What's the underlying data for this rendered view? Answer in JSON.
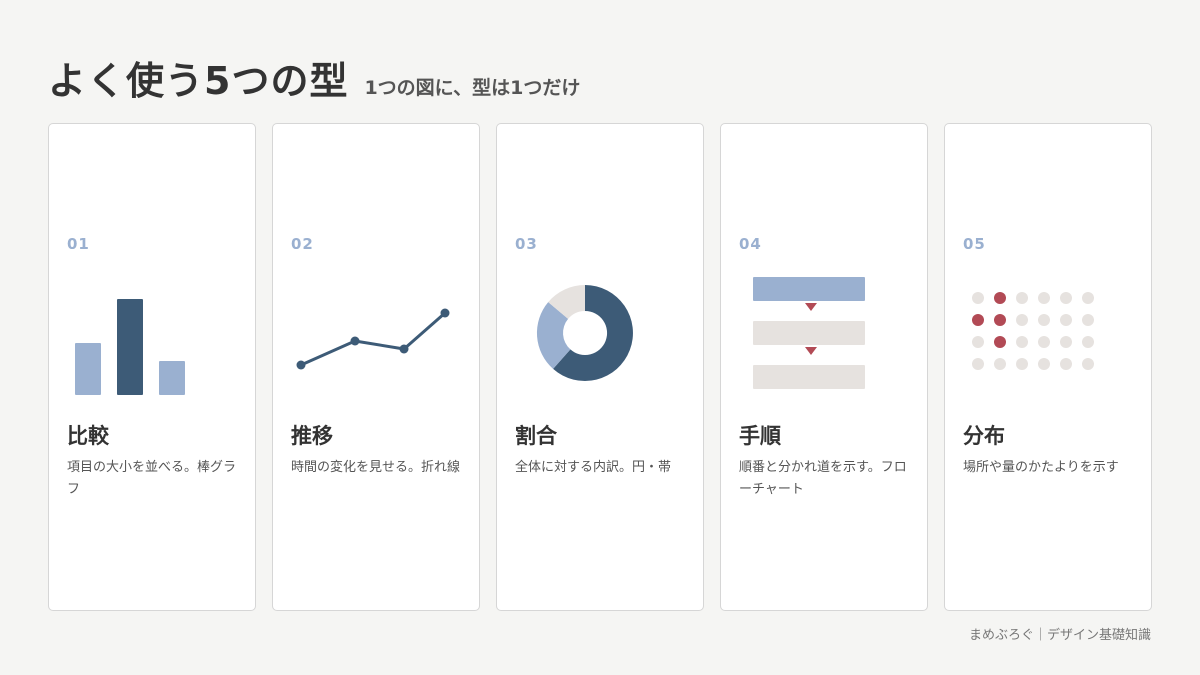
{
  "header": {
    "title": "よく使う5つの型",
    "subtitle": "1つの図に、型は1つだけ"
  },
  "colors": {
    "primary": "#3d5b77",
    "secondary": "#9ab0d0",
    "accent": "#b24a55",
    "neutral": "#e6e2df",
    "background": "#f5f5f3"
  },
  "cards": [
    {
      "number": "01",
      "title": "比較",
      "desc": "項目の大小を並べる。棒グラフ",
      "icon": "bar-chart-icon"
    },
    {
      "number": "02",
      "title": "推移",
      "desc": "時間の変化を見せる。折れ線",
      "icon": "line-chart-icon"
    },
    {
      "number": "03",
      "title": "割合",
      "desc": "全体に対する内訳。円・帯",
      "icon": "donut-chart-icon"
    },
    {
      "number": "04",
      "title": "手順",
      "desc": "順番と分かれ道を示す。フローチャート",
      "icon": "flowchart-icon"
    },
    {
      "number": "05",
      "title": "分布",
      "desc": "場所や量のかたよりを示す",
      "icon": "dot-distribution-icon"
    }
  ],
  "footer": {
    "credit": "まめぶろぐ｜デザイン基礎知識"
  }
}
